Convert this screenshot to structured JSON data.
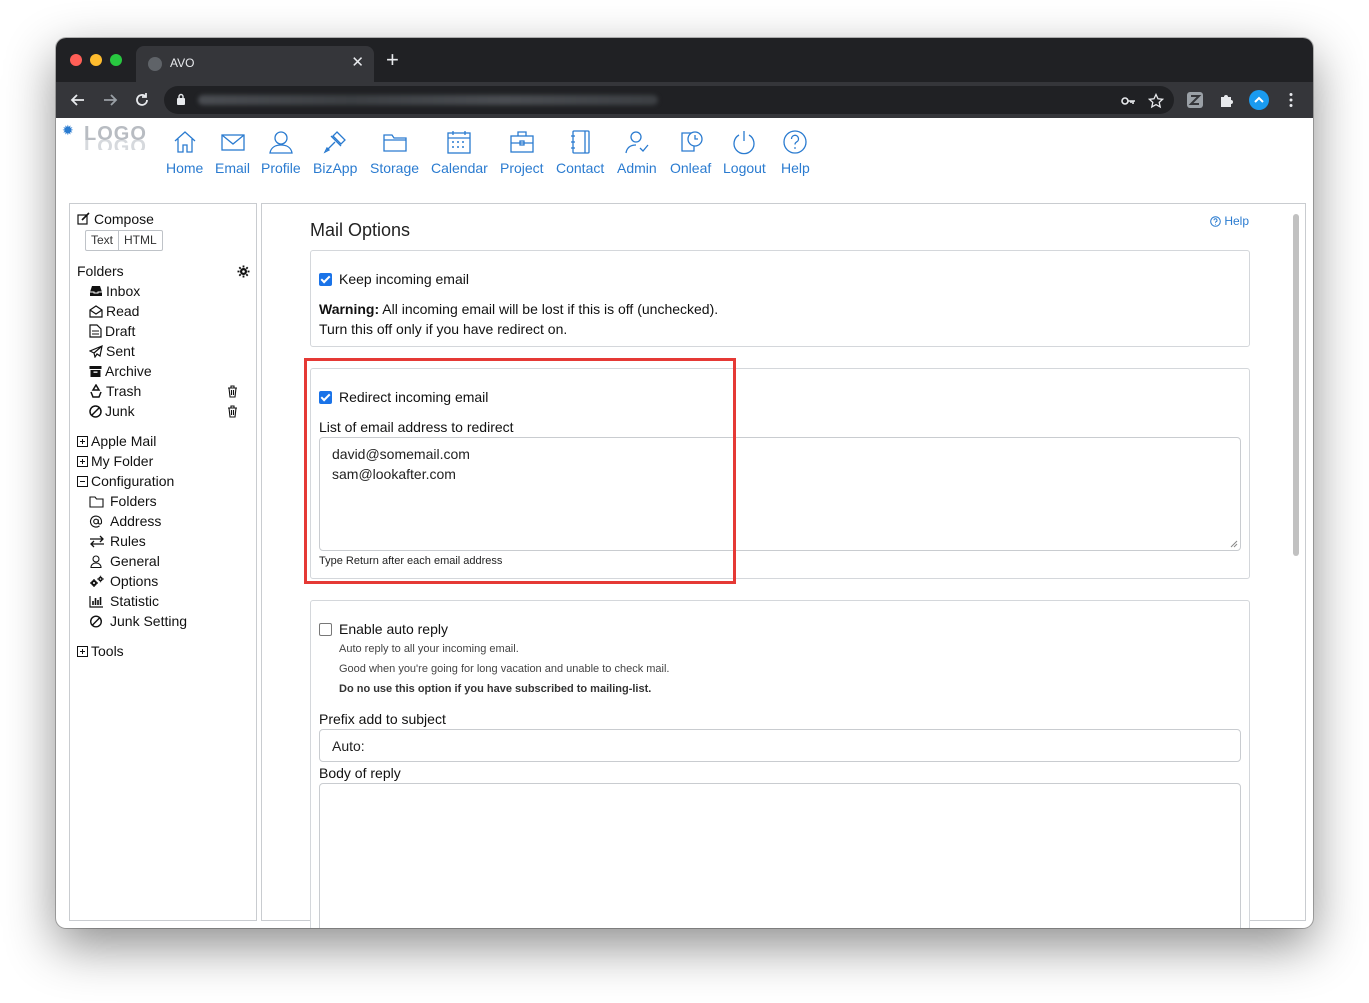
{
  "browser": {
    "tab_title": "AVO",
    "tab_close": "✕",
    "new_tab": "+",
    "url": ""
  },
  "app": {
    "logo": "LOGO",
    "nav": [
      {
        "label": "Home",
        "icon": "home-icon"
      },
      {
        "label": "Email",
        "icon": "email-icon"
      },
      {
        "label": "Profile",
        "icon": "profile-icon"
      },
      {
        "label": "BizApp",
        "icon": "bizapp-icon"
      },
      {
        "label": "Storage",
        "icon": "storage-icon"
      },
      {
        "label": "Calendar",
        "icon": "calendar-icon"
      },
      {
        "label": "Project",
        "icon": "project-icon"
      },
      {
        "label": "Contact",
        "icon": "contact-icon"
      },
      {
        "label": "Admin",
        "icon": "admin-icon"
      },
      {
        "label": "Onleaf",
        "icon": "onleaf-icon"
      },
      {
        "label": "Logout",
        "icon": "logout-icon"
      },
      {
        "label": "Help",
        "icon": "help-icon"
      }
    ]
  },
  "sidebar": {
    "compose": "Compose",
    "compose_modes": [
      "Text",
      "HTML"
    ],
    "folders_label": "Folders",
    "folders": [
      {
        "label": "Inbox",
        "icon": "inbox-icon"
      },
      {
        "label": "Read",
        "icon": "read-icon"
      },
      {
        "label": "Draft",
        "icon": "draft-icon"
      },
      {
        "label": "Sent",
        "icon": "sent-icon"
      },
      {
        "label": "Archive",
        "icon": "archive-icon"
      },
      {
        "label": "Trash",
        "icon": "trash-icon"
      },
      {
        "label": "Junk",
        "icon": "junk-icon"
      }
    ],
    "groups": [
      "Apple Mail",
      "My Folder",
      "Configuration"
    ],
    "config_items": [
      {
        "label": "Folders",
        "icon": "folder-icon"
      },
      {
        "label": "Address",
        "icon": "at-icon"
      },
      {
        "label": "Rules",
        "icon": "rules-icon"
      },
      {
        "label": "General",
        "icon": "general-icon"
      },
      {
        "label": "Options",
        "icon": "options-icon"
      },
      {
        "label": "Statistic",
        "icon": "statistic-icon"
      },
      {
        "label": "Junk Setting",
        "icon": "junk-setting-icon"
      }
    ],
    "tools": "Tools"
  },
  "main": {
    "title": "Mail Options",
    "help": "Help",
    "keep": {
      "label": "Keep incoming email",
      "checked": true,
      "warning_bold": "Warning:",
      "warning_text": " All incoming email will be lost if this is off (unchecked).",
      "warning_line2": "Turn this off only if you have redirect on."
    },
    "redirect": {
      "label": "Redirect incoming email",
      "checked": true,
      "list_label": "List of email address to redirect",
      "addresses": [
        "david@somemail.com",
        "sam@lookafter.com"
      ],
      "hint": "Type Return after each email address"
    },
    "autoreply": {
      "label": "Enable auto reply",
      "checked": false,
      "desc1": "Auto reply to all your incoming email.",
      "desc2": "Good when you're going for long vacation and unable to check mail.",
      "desc3": "Do no use this option if you have subscribed to mailing-list.",
      "prefix_label": "Prefix add to subject",
      "prefix_value": "Auto:",
      "body_label": "Body of reply",
      "body_value": ""
    }
  },
  "colors": {
    "link_blue": "#2a7bd0",
    "highlight_red": "#e53935",
    "checkbox_blue": "#1a73e8"
  }
}
